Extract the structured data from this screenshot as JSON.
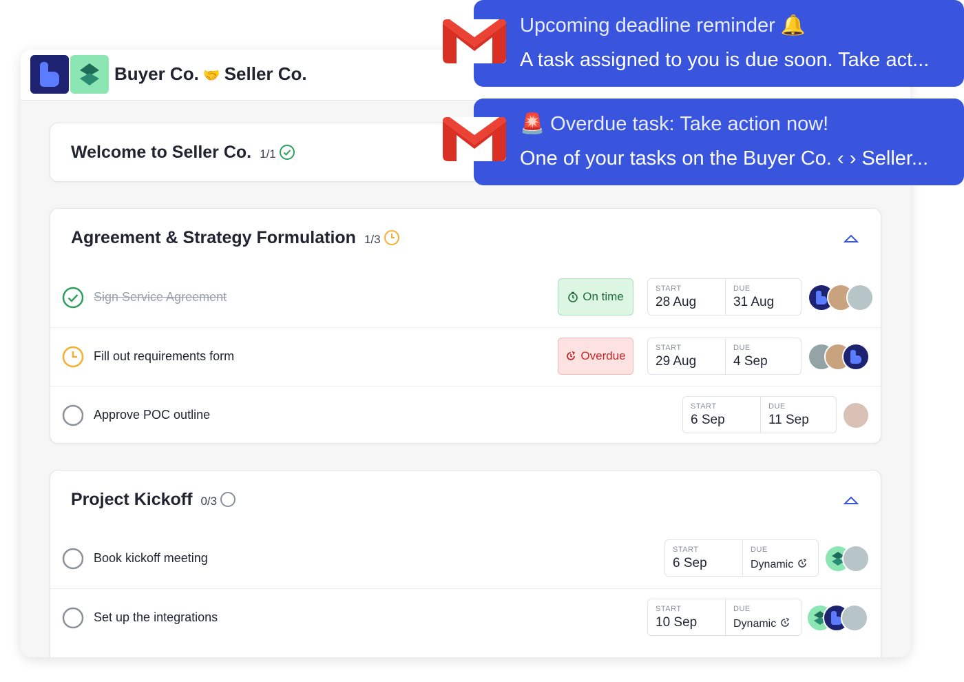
{
  "header": {
    "buyer": "Buyer Co.",
    "handshake": "🤝",
    "seller": "Seller Co."
  },
  "welcome": {
    "title": "Welcome to Seller Co.",
    "progress": "1/1"
  },
  "sections": [
    {
      "title": "Agreement & Strategy Formulation",
      "progress": "1/3",
      "tasks": [
        {
          "name": "Sign Service Agreement",
          "status_badge": "On time",
          "start_label": "START",
          "start": "28 Aug",
          "due_label": "DUE",
          "due": "31 Aug"
        },
        {
          "name": "Fill out requirements form",
          "status_badge": "Overdue",
          "start_label": "START",
          "start": "29 Aug",
          "due_label": "DUE",
          "due": "4 Sep"
        },
        {
          "name": "Approve POC outline",
          "start_label": "START",
          "start": "6 Sep",
          "due_label": "DUE",
          "due": "11 Sep"
        }
      ]
    },
    {
      "title": "Project Kickoff",
      "progress": "0/3",
      "tasks": [
        {
          "name": "Book kickoff meeting",
          "start_label": "START",
          "start": "6 Sep",
          "due_label": "DUE",
          "due": "Dynamic"
        },
        {
          "name": "Set up the integrations",
          "start_label": "START",
          "start": "10 Sep",
          "due_label": "DUE",
          "due": "Dynamic"
        }
      ]
    }
  ],
  "notifications": [
    {
      "title": "Upcoming deadline reminder 🔔",
      "body": "A task assigned to you is due soon. Take act..."
    },
    {
      "title": "🚨 Overdue task: Take action now!",
      "body": "One of your tasks on the Buyer Co. ‹ › Seller..."
    }
  ],
  "colors": {
    "accent_blue": "#3a55dd",
    "success_green": "#2e9e5b",
    "pending_orange": "#f5b030",
    "danger_red": "#c22a2a"
  },
  "icons": [
    "buyer-logo-icon",
    "seller-logo-icon",
    "check-circle-icon",
    "clock-icon",
    "empty-circle-icon",
    "chevron-up-icon",
    "stopwatch-icon",
    "overdue-icon",
    "dynamic-icon",
    "gmail-icon"
  ]
}
